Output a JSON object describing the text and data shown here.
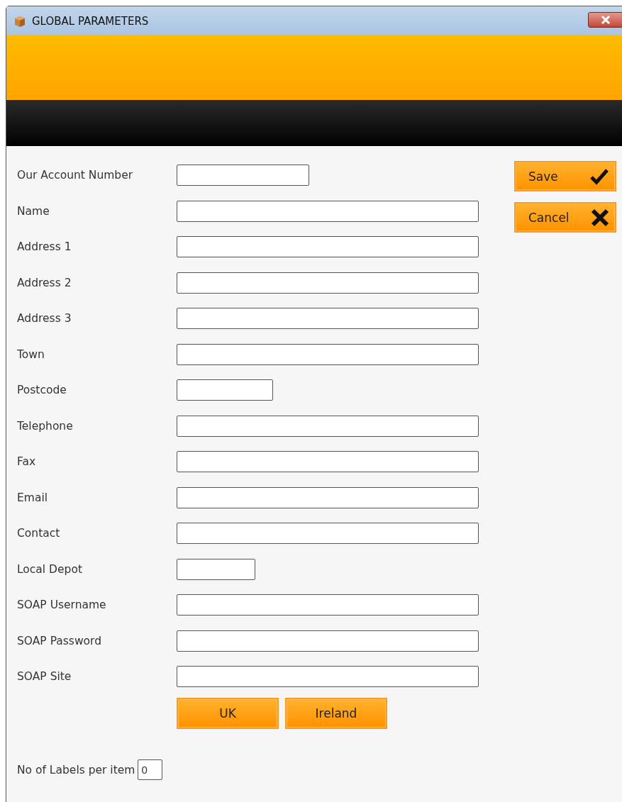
{
  "window": {
    "title": "GLOBAL PARAMETERS"
  },
  "fields": [
    {
      "label": "Our Account Number",
      "kind": "medium"
    },
    {
      "label": "Name",
      "kind": "wide"
    },
    {
      "label": "Address 1",
      "kind": "wide"
    },
    {
      "label": "Address 2",
      "kind": "wide"
    },
    {
      "label": "Address 3",
      "kind": "wide"
    },
    {
      "label": "Town",
      "kind": "wide"
    },
    {
      "label": "Postcode",
      "kind": "small"
    },
    {
      "label": "Telephone",
      "kind": "wide"
    },
    {
      "label": "Fax",
      "kind": "wide"
    },
    {
      "label": "Email",
      "kind": "wide"
    },
    {
      "label": "Contact",
      "kind": "wide"
    },
    {
      "label": "Local Depot",
      "kind": "narrow"
    },
    {
      "label": "SOAP Username",
      "kind": "wide"
    },
    {
      "label": "SOAP Password",
      "kind": "wide"
    },
    {
      "label": "SOAP Site",
      "kind": "wide"
    }
  ],
  "region_buttons": [
    "UK",
    "Ireland"
  ],
  "labels_per_item": {
    "label": "No of Labels per item",
    "value": "0"
  },
  "actions": [
    {
      "label": "Save",
      "kind": "save"
    },
    {
      "label": "Cancel",
      "kind": "cancel"
    }
  ]
}
